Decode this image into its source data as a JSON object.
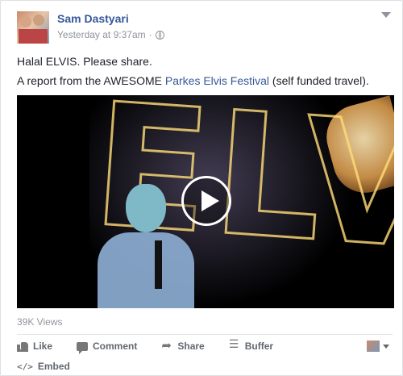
{
  "post": {
    "author": "Sam Dastyari",
    "timestamp": "Yesterday at 9:37am",
    "separator": "·",
    "line1": "Halal ELVIS. Please share.",
    "line2_prefix": "A report from the AWESOME ",
    "line2_link": "Parkes Elvis Festival",
    "line2_suffix": " (self funded travel).",
    "views": "39K Views"
  },
  "actions": {
    "like": "Like",
    "comment": "Comment",
    "share": "Share",
    "buffer": "Buffer",
    "embed": "Embed",
    "embed_icon": "</>"
  },
  "icons": [
    "globe-icon",
    "chevron-down-icon",
    "like-icon",
    "comment-icon",
    "share-icon",
    "buffer-icon",
    "code-icon",
    "play-icon"
  ]
}
